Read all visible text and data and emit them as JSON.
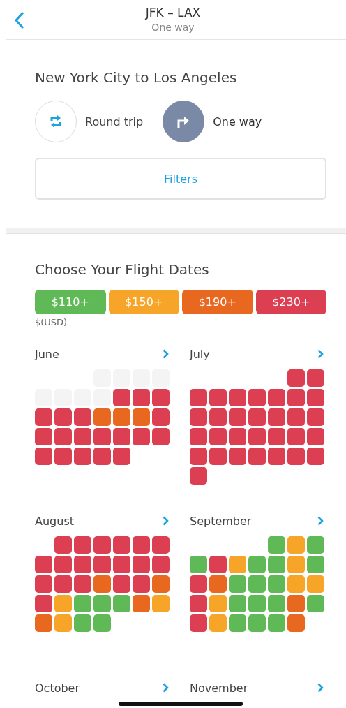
{
  "header": {
    "title": "JFK – LAX",
    "subtitle": "One way"
  },
  "trip": {
    "title": "New York City to Los Angeles",
    "options": [
      {
        "kind": "round",
        "label": "Round trip",
        "selected": false
      },
      {
        "kind": "oneway",
        "label": "One way",
        "selected": true
      }
    ],
    "filters": "Filters"
  },
  "dates": {
    "title": "Choose Your Flight Dates",
    "currency": "$(USD)",
    "legend": [
      {
        "label": "$110+",
        "color": "#5fb957"
      },
      {
        "label": "$150+",
        "color": "#f7a529"
      },
      {
        "label": "$190+",
        "color": "#e9681f"
      },
      {
        "label": "$230+",
        "color": "#dc3e52"
      }
    ],
    "months": [
      {
        "name": "June",
        "days": [
          {
            "kind": "blank"
          },
          {
            "kind": "blank"
          },
          {
            "kind": "blank"
          },
          {
            "kind": "past"
          },
          {
            "kind": "past"
          },
          {
            "kind": "past"
          },
          {
            "kind": "past"
          },
          {
            "kind": "past"
          },
          {
            "kind": "past"
          },
          {
            "kind": "past"
          },
          {
            "kind": "past"
          },
          {
            "kind": "day",
            "color": "#dc3e52"
          },
          {
            "kind": "day",
            "color": "#dc3e52"
          },
          {
            "kind": "day",
            "color": "#dc3e52"
          },
          {
            "kind": "day",
            "color": "#dc3e52"
          },
          {
            "kind": "day",
            "color": "#dc3e52"
          },
          {
            "kind": "day",
            "color": "#dc3e52"
          },
          {
            "kind": "day",
            "color": "#e9681f"
          },
          {
            "kind": "day",
            "color": "#e9681f"
          },
          {
            "kind": "day",
            "color": "#e9681f"
          },
          {
            "kind": "day",
            "color": "#dc3e52"
          },
          {
            "kind": "day",
            "color": "#dc3e52"
          },
          {
            "kind": "day",
            "color": "#dc3e52"
          },
          {
            "kind": "day",
            "color": "#dc3e52"
          },
          {
            "kind": "day",
            "color": "#dc3e52"
          },
          {
            "kind": "day",
            "color": "#dc3e52"
          },
          {
            "kind": "day",
            "color": "#dc3e52"
          },
          {
            "kind": "day",
            "color": "#dc3e52"
          },
          {
            "kind": "day",
            "color": "#dc3e52"
          },
          {
            "kind": "day",
            "color": "#dc3e52"
          },
          {
            "kind": "day",
            "color": "#dc3e52"
          },
          {
            "kind": "day",
            "color": "#dc3e52"
          },
          {
            "kind": "day",
            "color": "#dc3e52"
          }
        ]
      },
      {
        "name": "July",
        "days": [
          {
            "kind": "blank"
          },
          {
            "kind": "blank"
          },
          {
            "kind": "blank"
          },
          {
            "kind": "blank"
          },
          {
            "kind": "blank"
          },
          {
            "kind": "day",
            "color": "#dc3e52"
          },
          {
            "kind": "day",
            "color": "#dc3e52"
          },
          {
            "kind": "day",
            "color": "#dc3e52"
          },
          {
            "kind": "day",
            "color": "#dc3e52"
          },
          {
            "kind": "day",
            "color": "#dc3e52"
          },
          {
            "kind": "day",
            "color": "#dc3e52"
          },
          {
            "kind": "day",
            "color": "#dc3e52"
          },
          {
            "kind": "day",
            "color": "#dc3e52"
          },
          {
            "kind": "day",
            "color": "#dc3e52"
          },
          {
            "kind": "day",
            "color": "#dc3e52"
          },
          {
            "kind": "day",
            "color": "#dc3e52"
          },
          {
            "kind": "day",
            "color": "#dc3e52"
          },
          {
            "kind": "day",
            "color": "#dc3e52"
          },
          {
            "kind": "day",
            "color": "#dc3e52"
          },
          {
            "kind": "day",
            "color": "#dc3e52"
          },
          {
            "kind": "day",
            "color": "#dc3e52"
          },
          {
            "kind": "day",
            "color": "#dc3e52"
          },
          {
            "kind": "day",
            "color": "#dc3e52"
          },
          {
            "kind": "day",
            "color": "#dc3e52"
          },
          {
            "kind": "day",
            "color": "#dc3e52"
          },
          {
            "kind": "day",
            "color": "#dc3e52"
          },
          {
            "kind": "day",
            "color": "#dc3e52"
          },
          {
            "kind": "day",
            "color": "#dc3e52"
          },
          {
            "kind": "day",
            "color": "#dc3e52"
          },
          {
            "kind": "day",
            "color": "#dc3e52"
          },
          {
            "kind": "day",
            "color": "#dc3e52"
          },
          {
            "kind": "day",
            "color": "#dc3e52"
          },
          {
            "kind": "day",
            "color": "#dc3e52"
          },
          {
            "kind": "day",
            "color": "#dc3e52"
          },
          {
            "kind": "day",
            "color": "#dc3e52"
          },
          {
            "kind": "day",
            "color": "#dc3e52"
          }
        ]
      },
      {
        "name": "August",
        "days": [
          {
            "kind": "blank"
          },
          {
            "kind": "day",
            "color": "#dc3e52"
          },
          {
            "kind": "day",
            "color": "#dc3e52"
          },
          {
            "kind": "day",
            "color": "#dc3e52"
          },
          {
            "kind": "day",
            "color": "#dc3e52"
          },
          {
            "kind": "day",
            "color": "#dc3e52"
          },
          {
            "kind": "day",
            "color": "#dc3e52"
          },
          {
            "kind": "day",
            "color": "#dc3e52"
          },
          {
            "kind": "day",
            "color": "#dc3e52"
          },
          {
            "kind": "day",
            "color": "#dc3e52"
          },
          {
            "kind": "day",
            "color": "#dc3e52"
          },
          {
            "kind": "day",
            "color": "#dc3e52"
          },
          {
            "kind": "day",
            "color": "#dc3e52"
          },
          {
            "kind": "day",
            "color": "#dc3e52"
          },
          {
            "kind": "day",
            "color": "#dc3e52"
          },
          {
            "kind": "day",
            "color": "#dc3e52"
          },
          {
            "kind": "day",
            "color": "#dc3e52"
          },
          {
            "kind": "day",
            "color": "#e9681f"
          },
          {
            "kind": "day",
            "color": "#dc3e52"
          },
          {
            "kind": "day",
            "color": "#dc3e52"
          },
          {
            "kind": "day",
            "color": "#e9681f"
          },
          {
            "kind": "day",
            "color": "#dc3e52"
          },
          {
            "kind": "day",
            "color": "#f7a529"
          },
          {
            "kind": "day",
            "color": "#5fb957"
          },
          {
            "kind": "day",
            "color": "#5fb957"
          },
          {
            "kind": "day",
            "color": "#5fb957"
          },
          {
            "kind": "day",
            "color": "#e9681f"
          },
          {
            "kind": "day",
            "color": "#f7a529"
          },
          {
            "kind": "day",
            "color": "#e9681f"
          },
          {
            "kind": "day",
            "color": "#f7a529"
          },
          {
            "kind": "day",
            "color": "#5fb957"
          },
          {
            "kind": "day",
            "color": "#5fb957"
          }
        ]
      },
      {
        "name": "September",
        "days": [
          {
            "kind": "blank"
          },
          {
            "kind": "blank"
          },
          {
            "kind": "blank"
          },
          {
            "kind": "blank"
          },
          {
            "kind": "day",
            "color": "#5fb957"
          },
          {
            "kind": "day",
            "color": "#f7a529"
          },
          {
            "kind": "day",
            "color": "#5fb957"
          },
          {
            "kind": "day",
            "color": "#5fb957"
          },
          {
            "kind": "day",
            "color": "#dc3e52"
          },
          {
            "kind": "day",
            "color": "#f7a529"
          },
          {
            "kind": "day",
            "color": "#5fb957"
          },
          {
            "kind": "day",
            "color": "#5fb957"
          },
          {
            "kind": "day",
            "color": "#f7a529"
          },
          {
            "kind": "day",
            "color": "#5fb957"
          },
          {
            "kind": "day",
            "color": "#dc3e52"
          },
          {
            "kind": "day",
            "color": "#e9681f"
          },
          {
            "kind": "day",
            "color": "#5fb957"
          },
          {
            "kind": "day",
            "color": "#5fb957"
          },
          {
            "kind": "day",
            "color": "#5fb957"
          },
          {
            "kind": "day",
            "color": "#f7a529"
          },
          {
            "kind": "day",
            "color": "#f7a529"
          },
          {
            "kind": "day",
            "color": "#dc3e52"
          },
          {
            "kind": "day",
            "color": "#f7a529"
          },
          {
            "kind": "day",
            "color": "#5fb957"
          },
          {
            "kind": "day",
            "color": "#5fb957"
          },
          {
            "kind": "day",
            "color": "#5fb957"
          },
          {
            "kind": "day",
            "color": "#e9681f"
          },
          {
            "kind": "day",
            "color": "#5fb957"
          },
          {
            "kind": "day",
            "color": "#dc3e52"
          },
          {
            "kind": "day",
            "color": "#f7a529"
          },
          {
            "kind": "day",
            "color": "#5fb957"
          },
          {
            "kind": "day",
            "color": "#5fb957"
          },
          {
            "kind": "day",
            "color": "#5fb957"
          },
          {
            "kind": "day",
            "color": "#e9681f"
          }
        ]
      },
      {
        "name": "October"
      },
      {
        "name": "November"
      }
    ]
  }
}
